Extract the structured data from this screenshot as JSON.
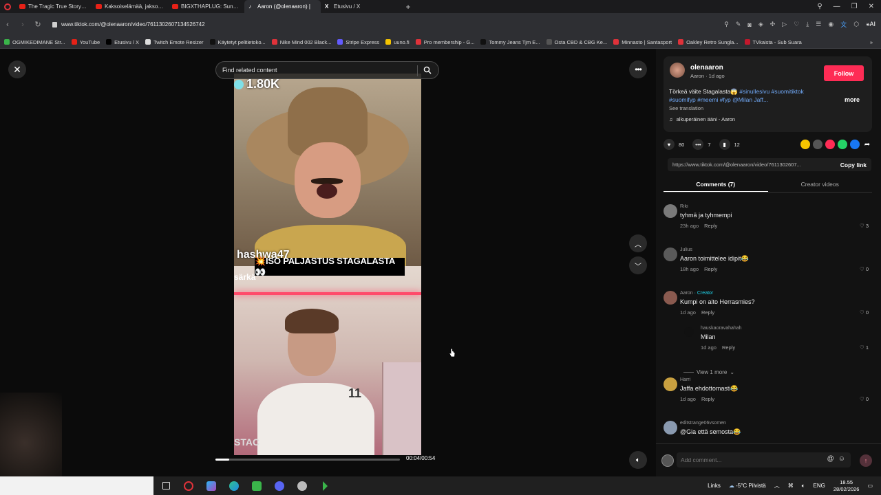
{
  "browser": {
    "tabs": [
      {
        "title": "The Tragic True Story of Ju",
        "icon": "youtube-icon",
        "active": false
      },
      {
        "title": "Kaksoiselämää, jakso 4 - Ul",
        "icon": "youtube-icon",
        "active": false
      },
      {
        "title": "BIGXTHAPLUG: Sundae C",
        "icon": "youtube-icon",
        "active": false
      },
      {
        "title": "Aaron (@olenaaron) |",
        "icon": "tiktok-icon",
        "active": true
      },
      {
        "title": "Etusivu / X",
        "icon": "x-icon",
        "active": false
      }
    ],
    "url": "www.tiktok.com/@olenaaron/video/7611302607134526742",
    "ai_label": "AI",
    "bookmarks": [
      {
        "label": "OGMIKEDIMANE Str...",
        "color": "#3ab54a"
      },
      {
        "label": "YouTube",
        "color": "#e62117"
      },
      {
        "label": "Etusivu / X",
        "color": "#000000"
      },
      {
        "label": "Twitch Emote Resizer",
        "color": "#dddddd"
      },
      {
        "label": "Käytetyt pelitietoko...",
        "color": "#111111"
      },
      {
        "label": "Nike Mind 002 Black...",
        "color": "#e0323a"
      },
      {
        "label": "Stripe Express",
        "color": "#635bff"
      },
      {
        "label": "uuno.fi",
        "color": "#f5c400"
      },
      {
        "label": "Pro membership - G...",
        "color": "#e0323a"
      },
      {
        "label": "Tommy Jeans Tjm E...",
        "color": "#111111"
      },
      {
        "label": "Osta CBD & CBG Ke...",
        "color": "#555555"
      },
      {
        "label": "Minnasto | Santasport",
        "color": "#e0323a"
      },
      {
        "label": "Oakley Retro Sungla...",
        "color": "#e0323a"
      },
      {
        "label": "TVkaista - Sub Suara",
        "color": "#c4182c"
      }
    ]
  },
  "player": {
    "search_placeholder": "Find related content",
    "viewer_count": "1.80K",
    "overlay_handle": "hashwa47",
    "overlay_sarita": "särkä",
    "banner_text": "💥ISO PALJASTUS STAGALASTA👀",
    "bottom_text": "STAC",
    "time": "00:04/00:54",
    "progress_fraction": 0.074
  },
  "post": {
    "author": "olenaaron",
    "author_sub": "Aaron · 1d ago",
    "follow_label": "Follow",
    "desc_plain": "Törkeä väite Stagalasta😱 ",
    "desc_tags_1": "#sinullesivu #suomitiktok",
    "desc_tags_2": "#suomifyp #meemi #fyp @Milan Jaff...",
    "more_label": "more",
    "see_translation": "See translation",
    "music": "alkuperäinen ääni - Aaron",
    "likes": "80",
    "comments_count": "7",
    "saves": "12",
    "link": "https://www.tiktok.com/@olenaaron/video/7611302607...",
    "copy_label": "Copy link",
    "tab_comments": "Comments (7)",
    "tab_creator": "Creator videos",
    "share_colors": [
      "#f5c400",
      "#555555",
      "#fe2c55",
      "#25d366",
      "#1877f2"
    ],
    "comments": [
      {
        "user": "Riki",
        "text": "tyhmä ja tyhmempi",
        "time": "23h ago",
        "likes": "3",
        "creator": "",
        "reply": "Reply"
      },
      {
        "user": "Julius",
        "text": "Aaron toimittelee idipit😂",
        "time": "18h ago",
        "likes": "0",
        "creator": "",
        "reply": "Reply"
      },
      {
        "user": "Aaron",
        "text": "Kumpi on aito Herrasmies?",
        "time": "1d ago",
        "likes": "0",
        "creator": "· Creator",
        "reply": "Reply"
      },
      {
        "user": "hauskaoravahahah",
        "text": "Milan",
        "time": "1d ago",
        "likes": "1",
        "creator": "",
        "reply": "Reply"
      },
      {
        "user": "Harri",
        "text": "Jaffa ehdottomasti😂",
        "time": "1d ago",
        "likes": "0",
        "creator": "",
        "reply": "Reply"
      },
      {
        "user": "editstrange06vsomen",
        "text": "@Gia että semosta😂",
        "time": "",
        "likes": "",
        "creator": "",
        "reply": ""
      }
    ],
    "view_more": "View 1 more",
    "add_comment_placeholder": "Add comment..."
  },
  "taskbar": {
    "links_label": "Links",
    "weather": "-5°C  Pilvistä",
    "lang": "ENG",
    "time": "18.55",
    "date": "28/02/2026"
  },
  "colors": {
    "accent": "#fe2c55",
    "hashtag": "#71a9f7",
    "creator_badge": "#20d5ec"
  }
}
